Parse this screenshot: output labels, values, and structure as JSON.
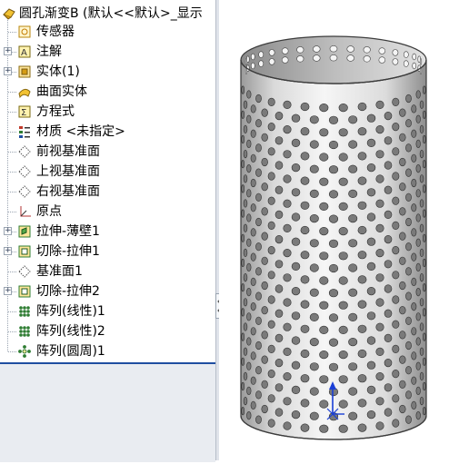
{
  "tree": {
    "root": {
      "label": "圆孔渐变B  (默认<<默认>_显示",
      "icon": "part-icon"
    },
    "items": [
      {
        "label": "传感器",
        "icon": "sensors-icon",
        "expandable": false
      },
      {
        "label": "注解",
        "icon": "annotations-icon",
        "expandable": true
      },
      {
        "label": "实体(1)",
        "icon": "solid-bodies-icon",
        "expandable": true
      },
      {
        "label": "曲面实体",
        "icon": "surface-bodies-icon",
        "expandable": false
      },
      {
        "label": "方程式",
        "icon": "equations-icon",
        "expandable": false
      },
      {
        "label": "材质 <未指定>",
        "icon": "material-icon",
        "expandable": false
      },
      {
        "label": "前视基准面",
        "icon": "plane-icon",
        "expandable": false
      },
      {
        "label": "上视基准面",
        "icon": "plane-icon",
        "expandable": false
      },
      {
        "label": "右视基准面",
        "icon": "plane-icon",
        "expandable": false
      },
      {
        "label": "原点",
        "icon": "origin-icon",
        "expandable": false
      },
      {
        "label": "拉伸-薄壁1",
        "icon": "extrude-icon",
        "expandable": true
      },
      {
        "label": "切除-拉伸1",
        "icon": "cut-extrude-icon",
        "expandable": true
      },
      {
        "label": "基准面1",
        "icon": "plane-icon",
        "expandable": false
      },
      {
        "label": "切除-拉伸2",
        "icon": "cut-extrude-icon",
        "expandable": true
      },
      {
        "label": "阵列(线性)1",
        "icon": "linear-pattern-icon",
        "expandable": false
      },
      {
        "label": "阵列(线性)2",
        "icon": "linear-pattern-icon",
        "expandable": false
      },
      {
        "label": "阵列(圆周)1",
        "icon": "circular-pattern-icon",
        "expandable": false
      }
    ]
  },
  "viewport": {
    "model": "perforated-cylinder",
    "colors": {
      "body": "#e6e6e6",
      "hole": "#7a7a7a",
      "edge": "#3c3c3c",
      "axis_y": "#1a3fd6"
    }
  }
}
